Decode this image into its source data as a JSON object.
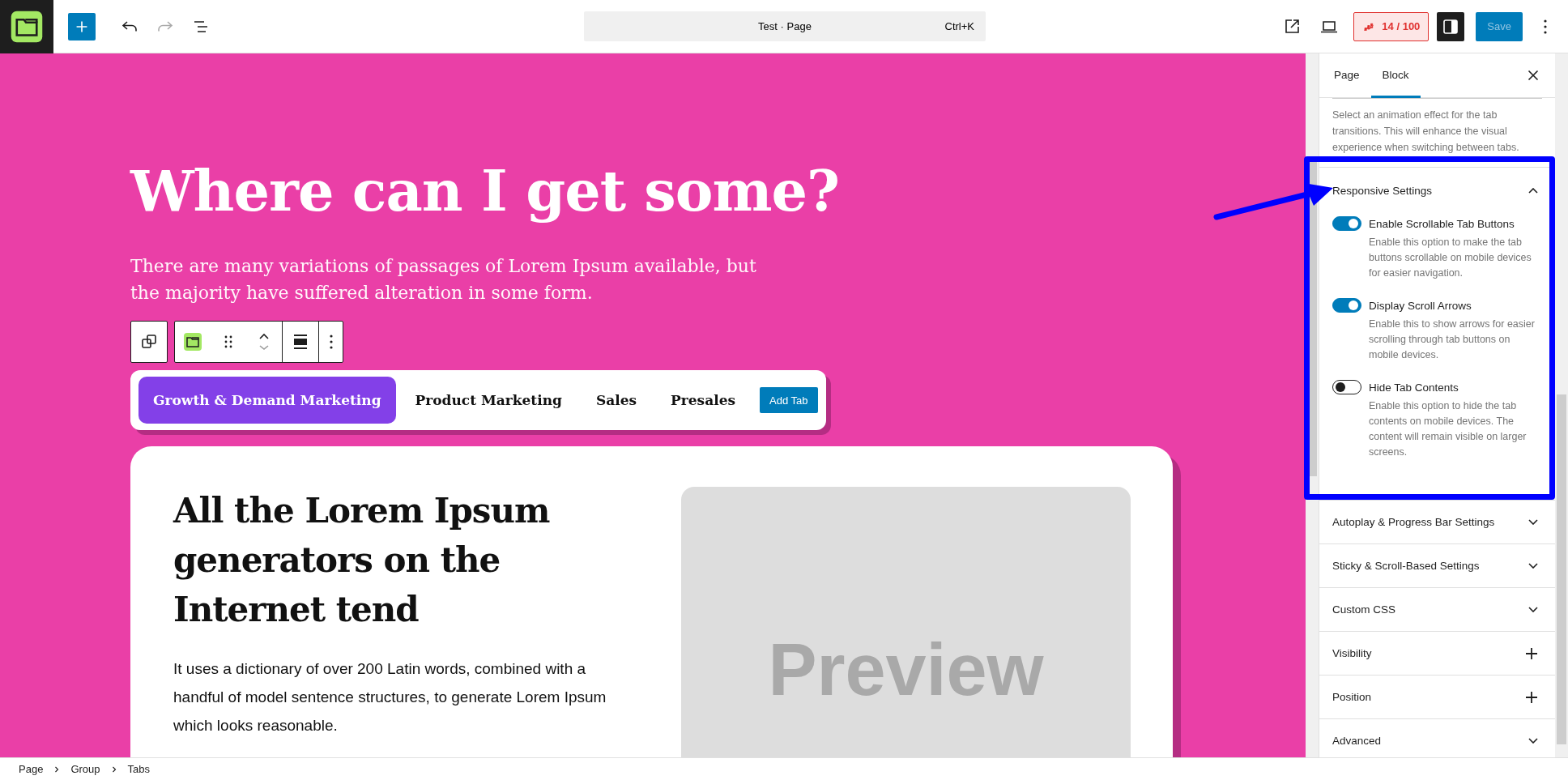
{
  "top_bar": {
    "document_title": "Test · Page",
    "shortcut": "Ctrl+K",
    "undo": {
      "disabled": false
    },
    "redo": {
      "disabled": true
    },
    "score": "14 / 100",
    "save": {
      "label": "Save",
      "disabled": true
    }
  },
  "canvas": {
    "heading": "Where can I get some?",
    "intro": "There are many variations of passages of Lorem Ipsum available, but the majority have suffered alteration in some form.",
    "tabs": [
      {
        "label": "Growth & Demand Marketing",
        "selected": true
      },
      {
        "label": "Product Marketing",
        "selected": false
      },
      {
        "label": "Sales",
        "selected": false
      },
      {
        "label": "Presales",
        "selected": false
      }
    ],
    "add_tab": "Add Tab",
    "card": {
      "heading": "All the Lorem Ipsum generators on the Internet tend",
      "paragraph": "It uses a dictionary of over 200 Latin words, combined with a handful of model sentence structures, to generate Lorem Ipsum which looks reasonable.",
      "preview": "Preview"
    }
  },
  "sidebar": {
    "tabs": [
      {
        "label": "Page",
        "selected": false
      },
      {
        "label": "Block",
        "selected": true
      }
    ],
    "animation_help": "Select an animation effect for the tab transitions. This will enhance the visual experience when switching between tabs.",
    "responsive": {
      "title": "Responsive Settings",
      "expanded": true,
      "toggles": [
        {
          "label": "Enable Scrollable Tab Buttons",
          "help": "Enable this option to make the tab buttons scrollable on mobile devices for easier navigation.",
          "on": true
        },
        {
          "label": "Display Scroll Arrows",
          "help": "Enable this to show arrows for easier scrolling through tab buttons on mobile devices.",
          "on": true
        },
        {
          "label": "Hide Tab Contents",
          "help": "Enable this option to hide the tab contents on mobile devices. The content will remain visible on larger screens.",
          "on": false
        }
      ]
    },
    "sections": [
      {
        "title": "Autoplay & Progress Bar Settings",
        "kind": "chevron"
      },
      {
        "title": "Sticky & Scroll-Based Settings",
        "kind": "chevron"
      },
      {
        "title": "Custom CSS",
        "kind": "chevron"
      },
      {
        "title": "Visibility",
        "kind": "plus"
      },
      {
        "title": "Position",
        "kind": "plus"
      },
      {
        "title": "Advanced",
        "kind": "chevron"
      }
    ]
  },
  "breadcrumb": [
    "Page",
    "Group",
    "Tabs"
  ]
}
